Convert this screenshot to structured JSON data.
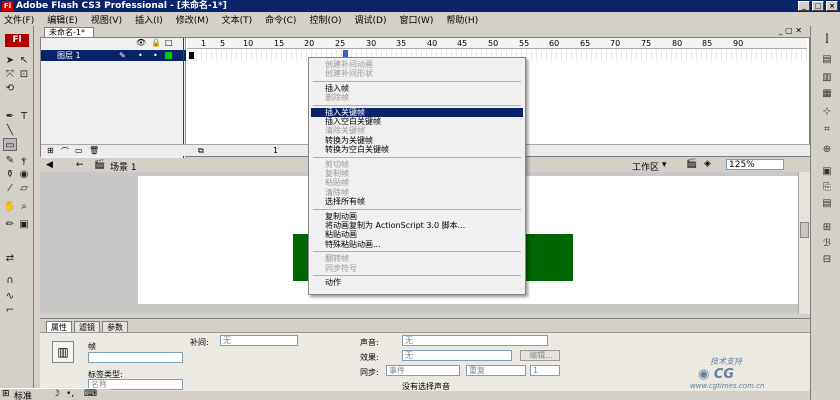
{
  "window": {
    "title": "Adobe Flash CS3 Professional - [未命名-1*]",
    "app_icon": "Fl"
  },
  "menu": [
    "文件(F)",
    "编辑(E)",
    "视图(V)",
    "插入(I)",
    "修改(M)",
    "文本(T)",
    "命令(C)",
    "控制(O)",
    "调试(D)",
    "窗口(W)",
    "帮助(H)"
  ],
  "tools": {
    "logo": "Fl"
  },
  "document_tab": {
    "label": "未命名-1*"
  },
  "timeline": {
    "ruler_ticks": [
      "1",
      "5",
      "10",
      "15",
      "20",
      "25",
      "30",
      "35",
      "40",
      "45",
      "50",
      "55",
      "60",
      "65",
      "70",
      "75",
      "80",
      "85",
      "90"
    ],
    "layer_name": "图层 1",
    "frame_num": "1"
  },
  "scene": {
    "label": "场景 1",
    "workspace": "工作区",
    "zoom": "125%"
  },
  "context_menu": {
    "items": [
      {
        "label": "创建补间动画",
        "disabled": true
      },
      {
        "label": "创建补间形状",
        "disabled": true
      },
      {
        "sep": true
      },
      {
        "label": "插入帧",
        "disabled": false
      },
      {
        "label": "删除帧",
        "disabled": true
      },
      {
        "sep": true
      },
      {
        "label": "插入关键帧",
        "disabled": false,
        "highlight": true
      },
      {
        "label": "插入空白关键帧",
        "disabled": false
      },
      {
        "label": "清除关键帧",
        "disabled": true
      },
      {
        "label": "转换为关键帧",
        "disabled": false
      },
      {
        "label": "转换为空白关键帧",
        "disabled": false
      },
      {
        "sep": true
      },
      {
        "label": "剪切帧",
        "disabled": true
      },
      {
        "label": "复制帧",
        "disabled": true
      },
      {
        "label": "粘贴帧",
        "disabled": true
      },
      {
        "label": "清除帧",
        "disabled": true
      },
      {
        "label": "选择所有帧",
        "disabled": false
      },
      {
        "sep": true
      },
      {
        "label": "复制动画",
        "disabled": false
      },
      {
        "label": "将动画复制为 ActionScript 3.0 脚本...",
        "disabled": false
      },
      {
        "label": "粘贴动画",
        "disabled": false
      },
      {
        "label": "特殊粘贴动画...",
        "disabled": false
      },
      {
        "sep": true
      },
      {
        "label": "翻转帧",
        "disabled": true
      },
      {
        "label": "同步符号",
        "disabled": true
      },
      {
        "sep": true
      },
      {
        "label": "动作",
        "disabled": false
      }
    ]
  },
  "properties": {
    "tabs": [
      "属性",
      "滤镜",
      "参数"
    ],
    "frame_label": "帧",
    "tween_label": "补间:",
    "tween_value": "无",
    "label_type_label": "标签类型:",
    "label_type_value": "名称",
    "sound_label": "声音:",
    "sound_value": "无",
    "effect_label": "效果:",
    "effect_value": "无",
    "edit_button": "编辑...",
    "sync_label": "同步:",
    "sync_value": "事件",
    "repeat_value": "重复",
    "repeat_count": "1",
    "no_sound": "没有选择声音"
  },
  "taskbar": {
    "label": "标准"
  },
  "watermark": {
    "line1": "技术支持",
    "line2": "www.cgtimes.com.cn"
  },
  "colors": {
    "stage_green": "#006600",
    "highlight": "#0a246a",
    "logo_red": "#b20000"
  }
}
